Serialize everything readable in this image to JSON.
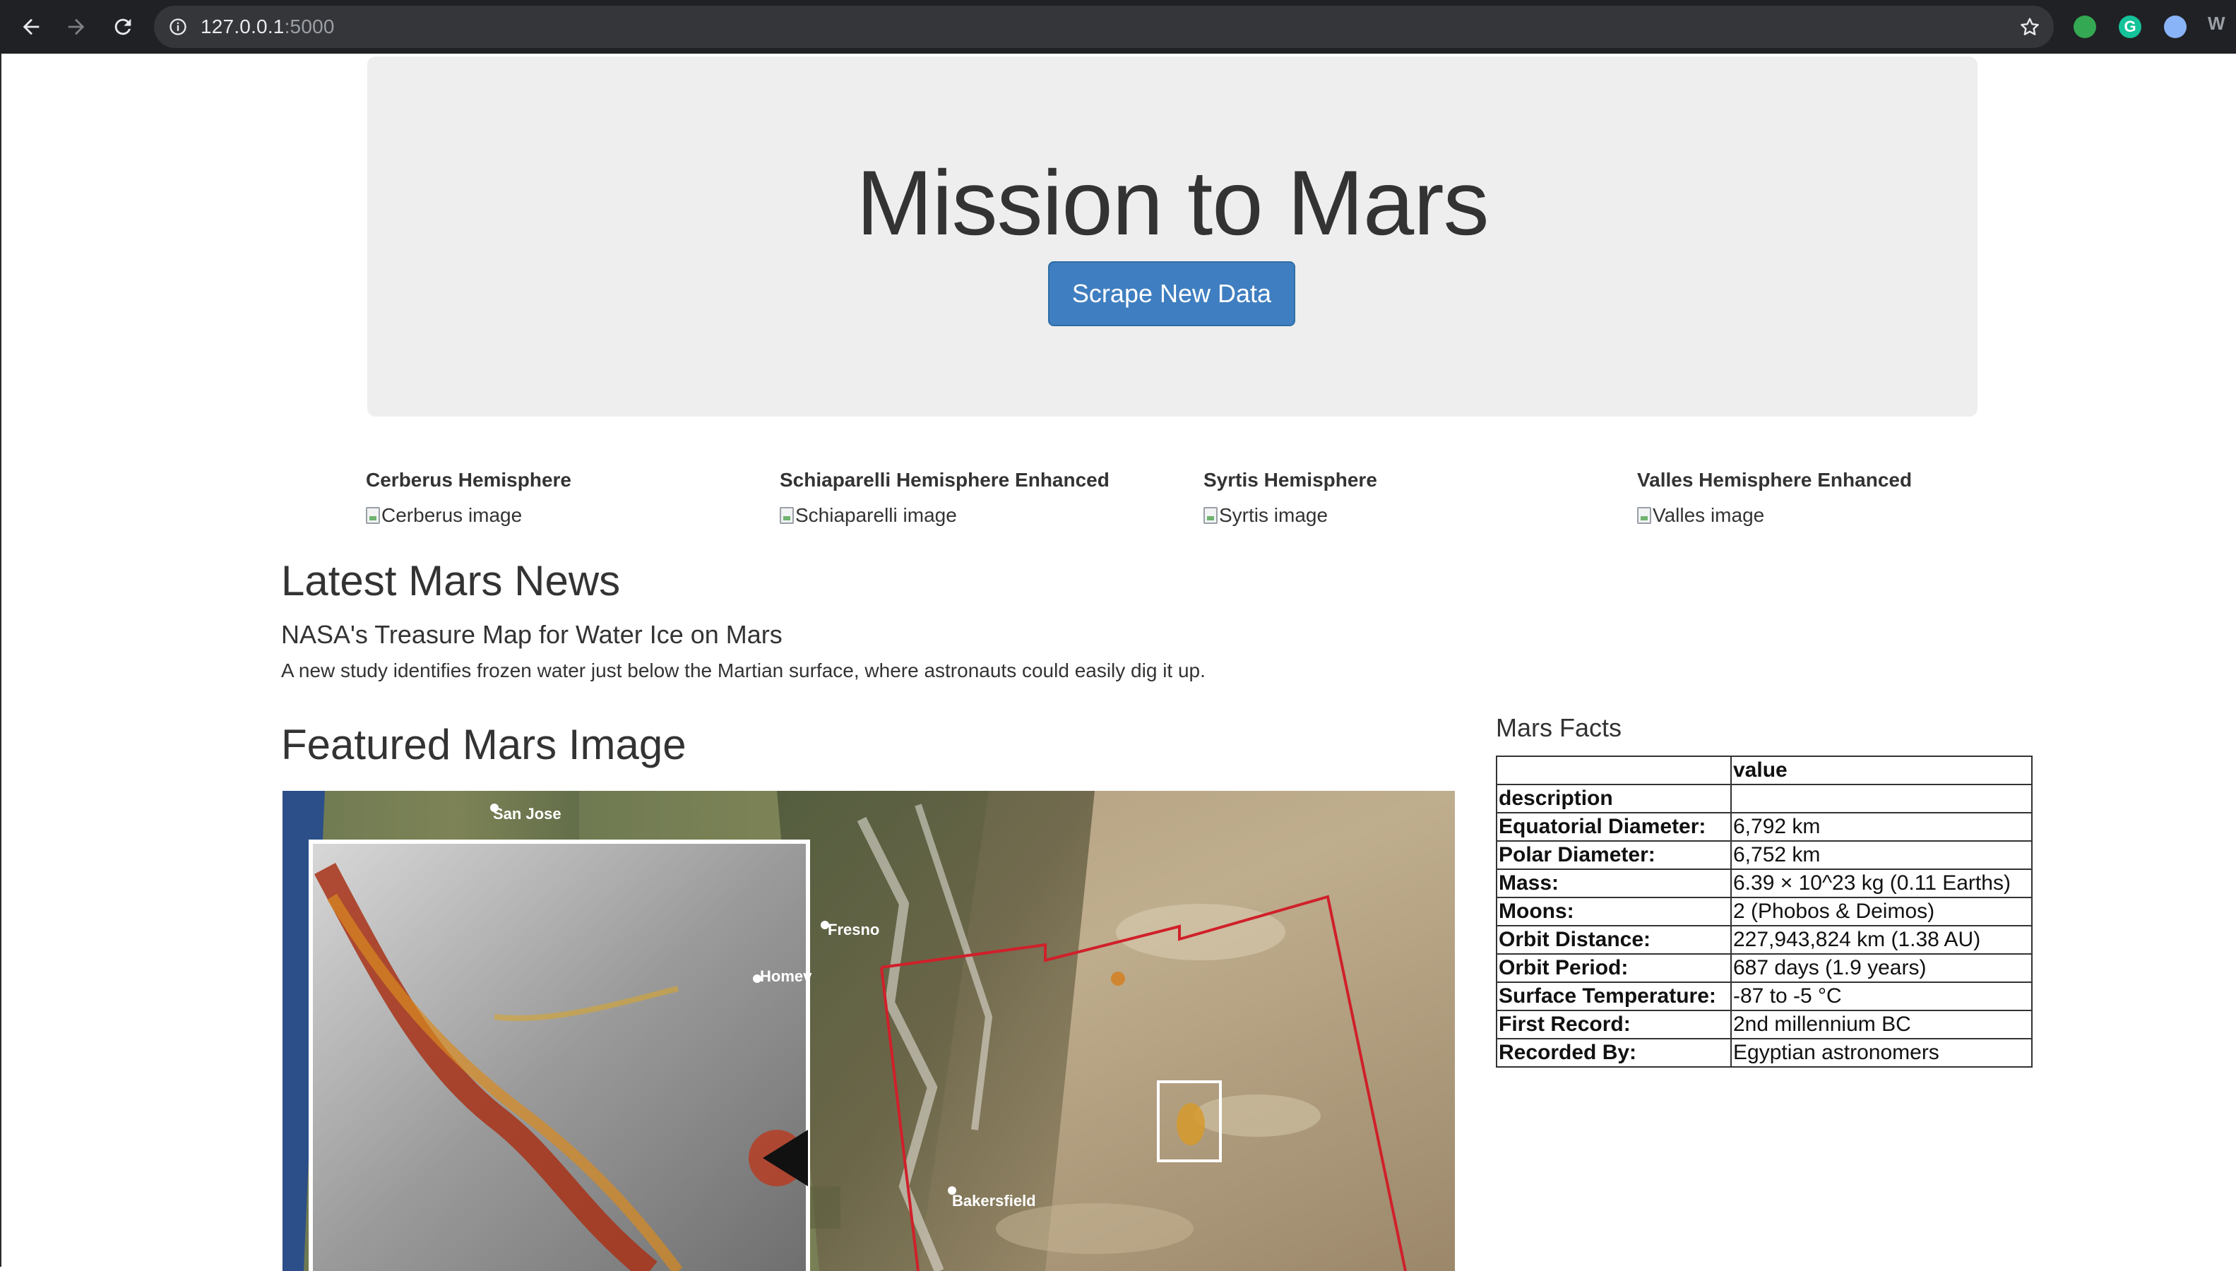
{
  "browser": {
    "url_host": "127.0.0.1",
    "url_port": ":5000",
    "extension_more": "W"
  },
  "jumbotron": {
    "title": "Mission to Mars",
    "button_label": "Scrape New Data"
  },
  "hemispheres": [
    {
      "title": "Cerberus Hemisphere",
      "alt": "Cerberus image"
    },
    {
      "title": "Schiaparelli Hemisphere Enhanced",
      "alt": "Schiaparelli image"
    },
    {
      "title": "Syrtis Hemisphere",
      "alt": "Syrtis image"
    },
    {
      "title": "Valles Hemisphere Enhanced",
      "alt": "Valles image"
    }
  ],
  "news": {
    "heading": "Latest Mars News",
    "title": "NASA's Treasure Map for Water Ice on Mars",
    "teaser": "A new study identifies frozen water just below the Martian surface, where astronauts could easily dig it up."
  },
  "featured": {
    "heading": "Featured Mars Image",
    "map_labels": [
      "San Jose",
      "Fresno",
      "Homev",
      "Bakersfield"
    ]
  },
  "facts": {
    "heading": "Mars Facts",
    "header_value": "value",
    "header_label": "description",
    "rows": [
      {
        "label": "Equatorial Diameter:",
        "value": "6,792 km"
      },
      {
        "label": "Polar Diameter:",
        "value": "6,752 km"
      },
      {
        "label": "Mass:",
        "value": "6.39 × 10^23 kg (0.11 Earths)"
      },
      {
        "label": "Moons:",
        "value": "2 (Phobos & Deimos)"
      },
      {
        "label": "Orbit Distance:",
        "value": "227,943,824 km (1.38 AU)"
      },
      {
        "label": "Orbit Period:",
        "value": "687 days (1.9 years)"
      },
      {
        "label": "Surface Temperature:",
        "value": "-87 to -5 °C"
      },
      {
        "label": "First Record:",
        "value": "2nd millennium BC"
      },
      {
        "label": "Recorded By:",
        "value": "Egyptian astronomers"
      }
    ]
  }
}
